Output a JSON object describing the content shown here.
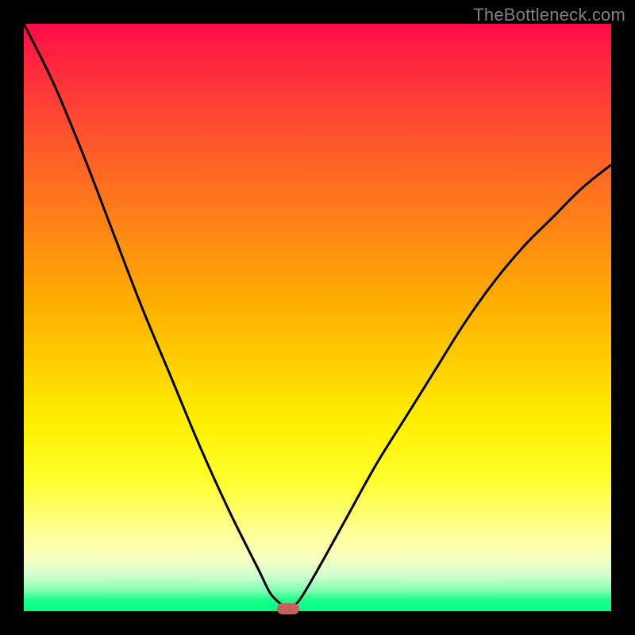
{
  "watermark": "TheBottleneck.com",
  "chart_data": {
    "type": "line",
    "title": "",
    "xlabel": "",
    "ylabel": "",
    "xlim": [
      0,
      100
    ],
    "ylim": [
      0,
      100
    ],
    "grid": false,
    "legend": false,
    "background_gradient": {
      "top": "#ff0a46",
      "middle": "#ffd000",
      "bottom": "#00ff80"
    },
    "series": [
      {
        "name": "bottleneck-curve-left",
        "x": [
          0,
          5,
          10,
          15,
          20,
          25,
          30,
          35,
          40,
          42,
          44,
          45
        ],
        "y": [
          100,
          90,
          78,
          65,
          52,
          40,
          28,
          17,
          7,
          3,
          1,
          0
        ]
      },
      {
        "name": "bottleneck-curve-right",
        "x": [
          45,
          47,
          50,
          55,
          60,
          65,
          70,
          75,
          80,
          85,
          90,
          95,
          100
        ],
        "y": [
          0,
          2,
          7,
          16,
          25,
          33,
          41,
          49,
          56,
          62,
          67,
          72,
          76
        ]
      }
    ],
    "annotations": [
      {
        "name": "optimal-marker",
        "x": 45,
        "y": 0,
        "color": "#c96060"
      }
    ]
  }
}
